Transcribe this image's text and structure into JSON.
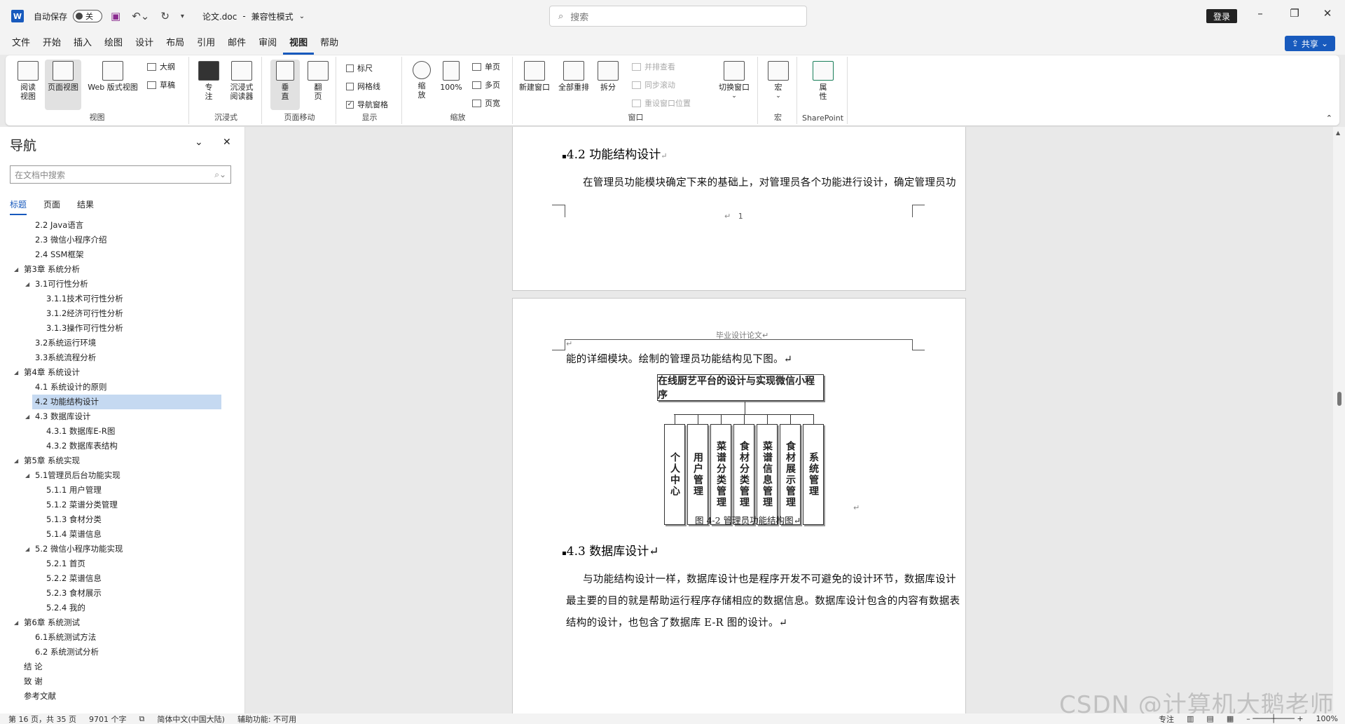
{
  "titlebar": {
    "app_logo": "W",
    "autosave_label": "自动保存",
    "autosave_state": "关",
    "doc_title": "论文.doc",
    "separator": "-",
    "compat_mode": "兼容性模式",
    "search_placeholder": "搜索",
    "login": "登录",
    "icons": [
      "save-icon",
      "undo-icon",
      "redo-icon",
      "customize-icon"
    ]
  },
  "menu": {
    "items": [
      "文件",
      "开始",
      "插入",
      "绘图",
      "设计",
      "布局",
      "引用",
      "邮件",
      "审阅",
      "视图",
      "帮助"
    ],
    "active": "视图",
    "share": "共享"
  },
  "ribbon": {
    "views": {
      "read": "阅读\n视图",
      "print": "页面视图",
      "web": "Web 版式视图",
      "outline": "大纲",
      "draft": "草稿",
      "group": "视图"
    },
    "immersive": {
      "focus": "专\n注",
      "reader": "沉浸式\n阅读器",
      "group": "沉浸式"
    },
    "pagemove": {
      "vertical": "垂\n直",
      "side": "翻\n页",
      "group": "页面移动"
    },
    "show": {
      "ruler": "标尺",
      "gridlines": "网格线",
      "navpane": "导航窗格",
      "navpane_checked": "✓",
      "group": "显示"
    },
    "zoom": {
      "zoom": "缩\n放",
      "hundred": "100%",
      "one_page": "单页",
      "multi_page": "多页",
      "page_width": "页宽",
      "group": "缩放"
    },
    "window": {
      "new_window": "新建窗口",
      "arrange_all": "全部重排",
      "split": "拆分",
      "side_by_side": "并排查看",
      "sync_scroll": "同步滚动",
      "reset_pos": "重设窗口位置",
      "switch": "切换窗口",
      "group": "窗口"
    },
    "macros": {
      "label": "宏",
      "group": "宏"
    },
    "sharepoint": {
      "label": "属\n性",
      "group": "SharePoint"
    }
  },
  "nav": {
    "title": "导航",
    "search_placeholder": "在文档中搜索",
    "tabs": [
      "标题",
      "页面",
      "结果"
    ],
    "outline": [
      {
        "text": "2.2 Java语言",
        "level": 2
      },
      {
        "text": "2.3 微信小程序介绍",
        "level": 2
      },
      {
        "text": "2.4 SSM框架",
        "level": 2
      },
      {
        "text": "第3章 系统分析",
        "level": 1,
        "expand": true
      },
      {
        "text": "3.1可行性分析",
        "level": 2,
        "expand": true
      },
      {
        "text": "3.1.1技术可行性分析",
        "level": 3
      },
      {
        "text": "3.1.2经济可行性分析",
        "level": 3
      },
      {
        "text": "3.1.3操作可行性分析",
        "level": 3
      },
      {
        "text": "3.2系统运行环境",
        "level": 2
      },
      {
        "text": "3.3系统流程分析",
        "level": 2
      },
      {
        "text": "第4章 系统设计",
        "level": 1,
        "expand": true
      },
      {
        "text": "4.1 系统设计的原则",
        "level": 2
      },
      {
        "text": "4.2 功能结构设计",
        "level": 2,
        "selected": true
      },
      {
        "text": "4.3 数据库设计",
        "level": 2,
        "expand": true
      },
      {
        "text": "4.3.1 数据库E-R图",
        "level": 3
      },
      {
        "text": "4.3.2 数据库表结构",
        "level": 3
      },
      {
        "text": "第5章 系统实现",
        "level": 1,
        "expand": true
      },
      {
        "text": "5.1管理员后台功能实现",
        "level": 2,
        "expand": true
      },
      {
        "text": "5.1.1 用户管理",
        "level": 3
      },
      {
        "text": "5.1.2 菜谱分类管理",
        "level": 3
      },
      {
        "text": "5.1.3 食材分类",
        "level": 3
      },
      {
        "text": "5.1.4 菜谱信息",
        "level": 3
      },
      {
        "text": "5.2 微信小程序功能实现",
        "level": 2,
        "expand": true
      },
      {
        "text": "5.2.1 首页",
        "level": 3
      },
      {
        "text": "5.2.2 菜谱信息",
        "level": 3
      },
      {
        "text": "5.2.3 食材展示",
        "level": 3
      },
      {
        "text": "5.2.4 我的",
        "level": 3
      },
      {
        "text": "第6章 系统测试",
        "level": 1,
        "expand": true
      },
      {
        "text": "6.1系统测试方法",
        "level": 2
      },
      {
        "text": "6.2 系统测试分析",
        "level": 2
      },
      {
        "text": "结  论",
        "level": 1
      },
      {
        "text": "致  谢",
        "level": 1
      },
      {
        "text": "参考文献",
        "level": 1
      }
    ]
  },
  "document": {
    "page1": {
      "heading": "4.2  功能结构设计",
      "para": "在管理员功能模块确定下来的基础上，对管理员各个功能进行设计，确定管理员功",
      "footer_mark": "↵",
      "page_number": "1"
    },
    "page2": {
      "header": "毕业设计论文↵",
      "header_para_mark": "↵",
      "line1": "能的详细模块。绘制的管理员功能结构见下图。↵",
      "diagram_root": "在线厨艺平台的设计与实现微信小程序",
      "diagram_nodes": [
        "个人中心",
        "用户管理",
        "菜谱分类管理",
        "食材分类管理",
        "菜谱信息管理",
        "食材展示管理",
        "系统管理"
      ],
      "diagram_mark": "↵",
      "caption": "图 4-2  管理员功能结构图↵",
      "heading": "4.3  数据库设计↵",
      "para_lines": [
        "与功能结构设计一样，数据库设计也是程序开发不可避免的设计环节，数据库设计",
        "最主要的目的就是帮助运行程序存储相应的数据信息。数据库设计包含的内容有数据表",
        "结构的设计，也包含了数据库 E-R 图的设计。↵"
      ]
    }
  },
  "status": {
    "page": "第 16 页，共 35 页",
    "words": "9701 个字",
    "lang": "简体中文(中国大陆)",
    "accessibility": "辅助功能: 不可用",
    "focus": "专注",
    "zoom": "100%"
  },
  "watermark": "CSDN @计算机大鹅老师",
  "colors": {
    "accent": "#185abd",
    "selected": "#c5d9f1"
  }
}
